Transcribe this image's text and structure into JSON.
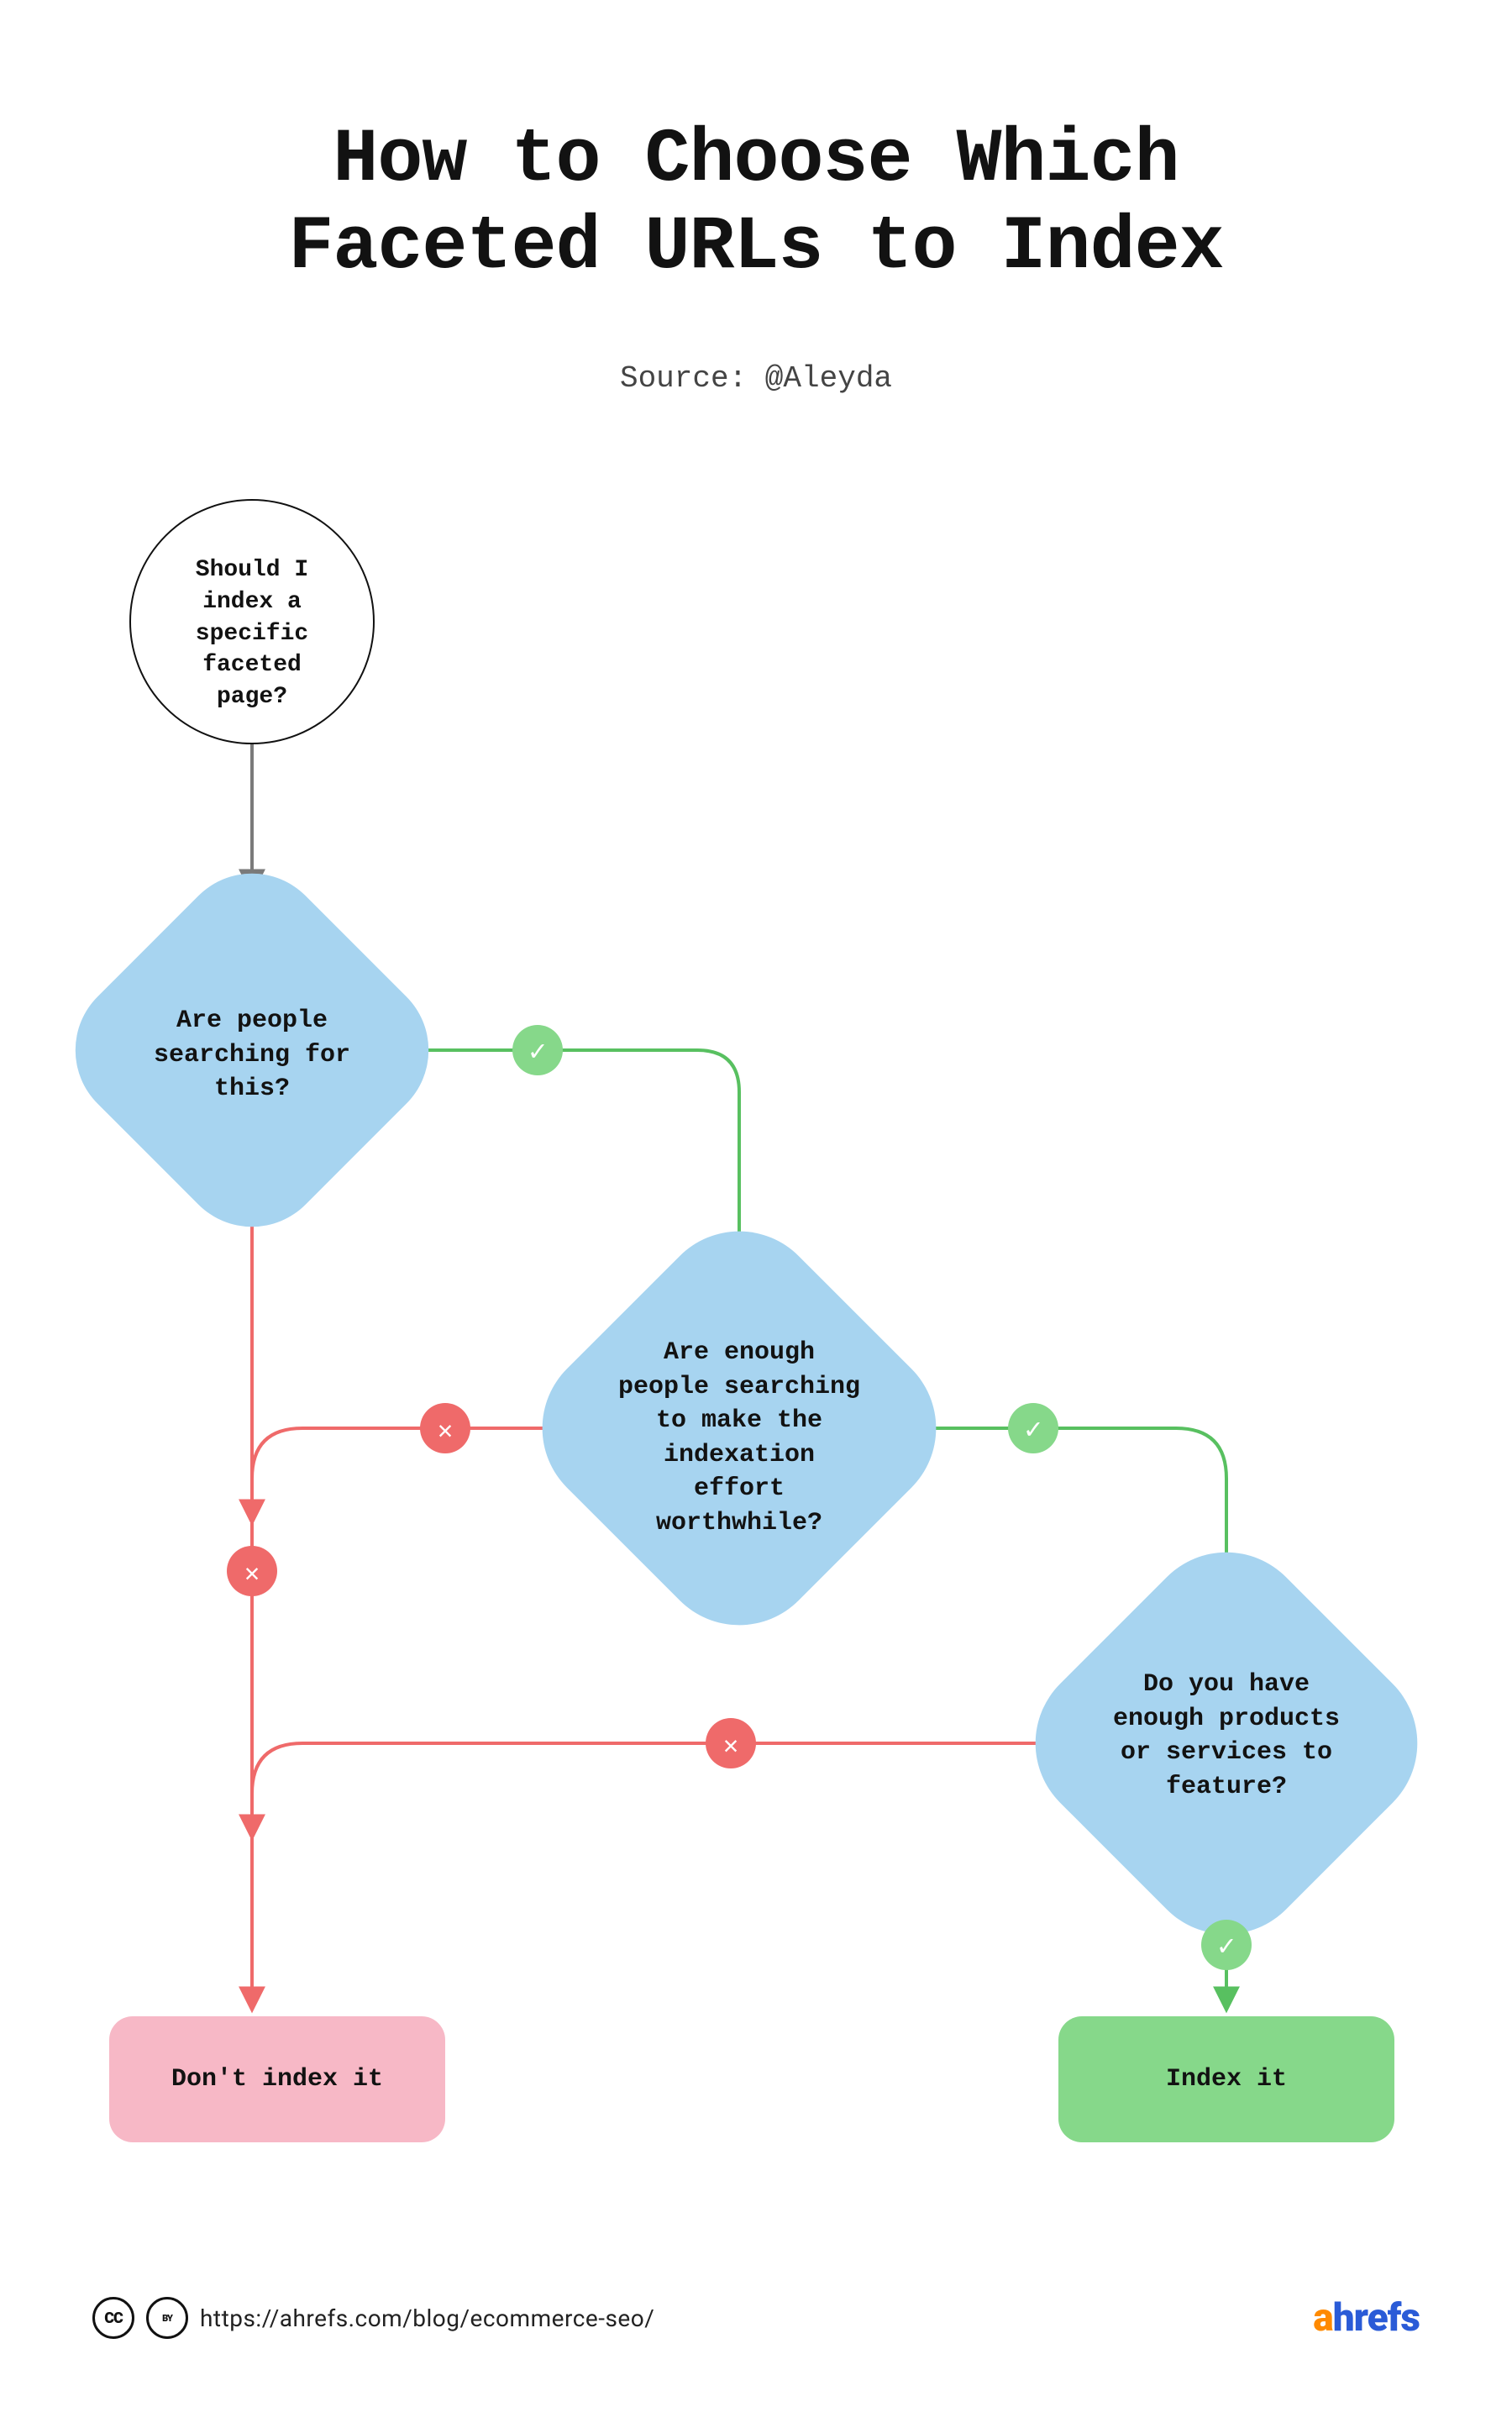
{
  "header": {
    "title_line1": "How to Choose Which",
    "title_line2": "Faceted URLs to Index",
    "source": "Source: @Aleyda"
  },
  "nodes": {
    "start": "Should I index a specific faceted page?",
    "q1": "Are people searching for this?",
    "q2": "Are enough people searching to make the indexation effort worthwhile?",
    "q3": "Do you have enough products or services to feature?",
    "no_end": "Don't index it",
    "yes_end": "Index it"
  },
  "badges": {
    "yes": "✓",
    "no": "✕"
  },
  "footer": {
    "cc": "CC",
    "by": "BY",
    "url": "https://ahrefs.com/blog/ecommerce-seo/",
    "brand_a": "a",
    "brand_rest": "hrefs"
  },
  "colors": {
    "blue": "#a7d4f0",
    "pink": "#f7b8c6",
    "green_fill": "#86d88a",
    "green_line": "#58c060",
    "red_line": "#ef6a6a",
    "grey_line": "#7a7a7a"
  }
}
